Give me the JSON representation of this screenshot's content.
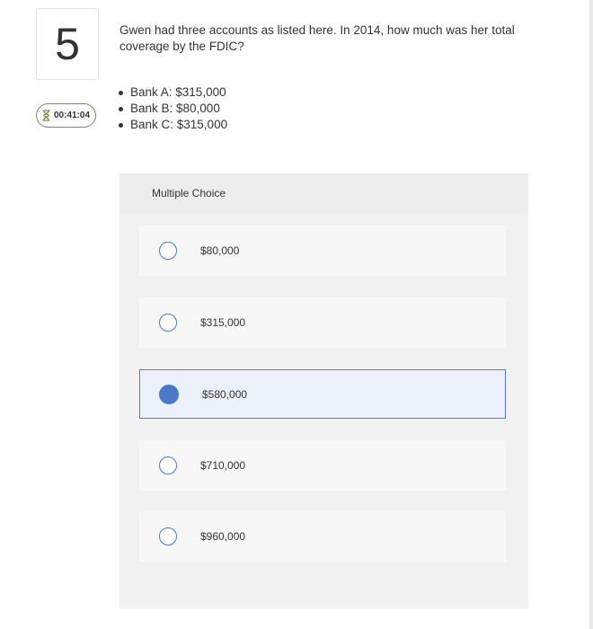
{
  "question": {
    "number": "5",
    "timer": "00:41:04",
    "text": "Gwen had three accounts as listed here. In 2014, how much was her total coverage by the FDIC?",
    "bullets": [
      "Bank A: $315,000",
      "Bank B: $80,000",
      "Bank C: $315,000"
    ]
  },
  "multiple_choice": {
    "header": "Multiple Choice",
    "options": [
      {
        "label": "$80,000",
        "selected": false
      },
      {
        "label": "$315,000",
        "selected": false
      },
      {
        "label": "$580,000",
        "selected": true
      },
      {
        "label": "$710,000",
        "selected": false
      },
      {
        "label": "$960,000",
        "selected": false
      }
    ]
  },
  "colors": {
    "accent_blue": "#4b79c8",
    "timer_border": "#6f8f4a",
    "selected_bg": "#eaf1fb"
  },
  "icons": {
    "timer": "hourglass-icon"
  }
}
